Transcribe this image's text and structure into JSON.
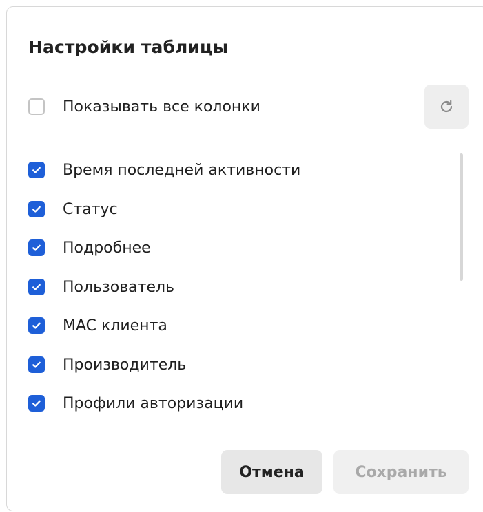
{
  "dialog": {
    "title": "Настройки таблицы",
    "show_all": {
      "label": "Показывать все колонки",
      "checked": false
    },
    "refresh_icon": "refresh-icon",
    "columns": [
      {
        "label": "Время последней активности",
        "checked": true
      },
      {
        "label": "Статус",
        "checked": true
      },
      {
        "label": "Подробнее",
        "checked": true
      },
      {
        "label": "Пользователь",
        "checked": true
      },
      {
        "label": "MAC клиента",
        "checked": true
      },
      {
        "label": "Производитель",
        "checked": true
      },
      {
        "label": "Профили авторизации",
        "checked": true
      }
    ],
    "buttons": {
      "cancel": "Отмена",
      "save": "Сохранить",
      "save_disabled": true
    },
    "colors": {
      "checkbox_checked": "#1e5fd8",
      "checkbox_border": "#c4c4c4",
      "cancel_bg": "#e7e7e7",
      "save_bg": "#f0f0f0",
      "save_text_disabled": "#a9a9a9"
    }
  }
}
